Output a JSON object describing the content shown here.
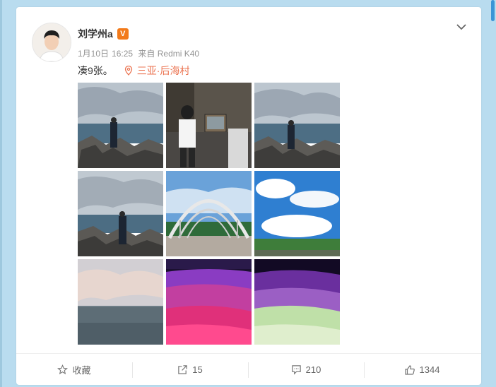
{
  "user": {
    "name": "刘学州a",
    "badge": "V"
  },
  "post": {
    "date": "1月10日",
    "time": "16:25",
    "source": "来自 Redmi K40",
    "text": "凑9张。",
    "location": "三亚·后海村"
  },
  "photos": [
    {
      "desc": "seaside-rocks-man-1"
    },
    {
      "desc": "cafe-tv-man"
    },
    {
      "desc": "seaside-rocks-man-2"
    },
    {
      "desc": "seaside-rocks-man-3"
    },
    {
      "desc": "arched-roof-building"
    },
    {
      "desc": "blue-sky-clouds"
    },
    {
      "desc": "sea-sunset-sky"
    },
    {
      "desc": "pink-light-floor"
    },
    {
      "desc": "purple-green-light-floor"
    }
  ],
  "actions": {
    "favorite": "收藏",
    "repost": "15",
    "comment": "210",
    "like": "1344"
  },
  "colors": {
    "accent": "#eb7350",
    "badge": "#f27a1a",
    "background": "#b9dcef"
  },
  "icons": [
    "star-icon",
    "repost-icon",
    "comment-icon",
    "like-icon",
    "location-icon",
    "chevron-down-icon"
  ]
}
